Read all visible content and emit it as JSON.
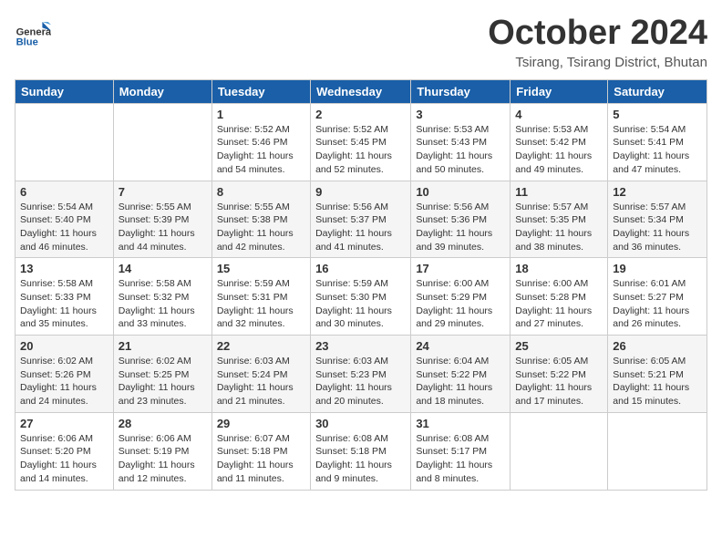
{
  "header": {
    "logo_general": "General",
    "logo_blue": "Blue",
    "month_title": "October 2024",
    "subtitle": "Tsirang, Tsirang District, Bhutan"
  },
  "days_of_week": [
    "Sunday",
    "Monday",
    "Tuesday",
    "Wednesday",
    "Thursday",
    "Friday",
    "Saturday"
  ],
  "weeks": [
    [
      {
        "day": "",
        "info": ""
      },
      {
        "day": "",
        "info": ""
      },
      {
        "day": "1",
        "info": "Sunrise: 5:52 AM\nSunset: 5:46 PM\nDaylight: 11 hours and 54 minutes."
      },
      {
        "day": "2",
        "info": "Sunrise: 5:52 AM\nSunset: 5:45 PM\nDaylight: 11 hours and 52 minutes."
      },
      {
        "day": "3",
        "info": "Sunrise: 5:53 AM\nSunset: 5:43 PM\nDaylight: 11 hours and 50 minutes."
      },
      {
        "day": "4",
        "info": "Sunrise: 5:53 AM\nSunset: 5:42 PM\nDaylight: 11 hours and 49 minutes."
      },
      {
        "day": "5",
        "info": "Sunrise: 5:54 AM\nSunset: 5:41 PM\nDaylight: 11 hours and 47 minutes."
      }
    ],
    [
      {
        "day": "6",
        "info": "Sunrise: 5:54 AM\nSunset: 5:40 PM\nDaylight: 11 hours and 46 minutes."
      },
      {
        "day": "7",
        "info": "Sunrise: 5:55 AM\nSunset: 5:39 PM\nDaylight: 11 hours and 44 minutes."
      },
      {
        "day": "8",
        "info": "Sunrise: 5:55 AM\nSunset: 5:38 PM\nDaylight: 11 hours and 42 minutes."
      },
      {
        "day": "9",
        "info": "Sunrise: 5:56 AM\nSunset: 5:37 PM\nDaylight: 11 hours and 41 minutes."
      },
      {
        "day": "10",
        "info": "Sunrise: 5:56 AM\nSunset: 5:36 PM\nDaylight: 11 hours and 39 minutes."
      },
      {
        "day": "11",
        "info": "Sunrise: 5:57 AM\nSunset: 5:35 PM\nDaylight: 11 hours and 38 minutes."
      },
      {
        "day": "12",
        "info": "Sunrise: 5:57 AM\nSunset: 5:34 PM\nDaylight: 11 hours and 36 minutes."
      }
    ],
    [
      {
        "day": "13",
        "info": "Sunrise: 5:58 AM\nSunset: 5:33 PM\nDaylight: 11 hours and 35 minutes."
      },
      {
        "day": "14",
        "info": "Sunrise: 5:58 AM\nSunset: 5:32 PM\nDaylight: 11 hours and 33 minutes."
      },
      {
        "day": "15",
        "info": "Sunrise: 5:59 AM\nSunset: 5:31 PM\nDaylight: 11 hours and 32 minutes."
      },
      {
        "day": "16",
        "info": "Sunrise: 5:59 AM\nSunset: 5:30 PM\nDaylight: 11 hours and 30 minutes."
      },
      {
        "day": "17",
        "info": "Sunrise: 6:00 AM\nSunset: 5:29 PM\nDaylight: 11 hours and 29 minutes."
      },
      {
        "day": "18",
        "info": "Sunrise: 6:00 AM\nSunset: 5:28 PM\nDaylight: 11 hours and 27 minutes."
      },
      {
        "day": "19",
        "info": "Sunrise: 6:01 AM\nSunset: 5:27 PM\nDaylight: 11 hours and 26 minutes."
      }
    ],
    [
      {
        "day": "20",
        "info": "Sunrise: 6:02 AM\nSunset: 5:26 PM\nDaylight: 11 hours and 24 minutes."
      },
      {
        "day": "21",
        "info": "Sunrise: 6:02 AM\nSunset: 5:25 PM\nDaylight: 11 hours and 23 minutes."
      },
      {
        "day": "22",
        "info": "Sunrise: 6:03 AM\nSunset: 5:24 PM\nDaylight: 11 hours and 21 minutes."
      },
      {
        "day": "23",
        "info": "Sunrise: 6:03 AM\nSunset: 5:23 PM\nDaylight: 11 hours and 20 minutes."
      },
      {
        "day": "24",
        "info": "Sunrise: 6:04 AM\nSunset: 5:22 PM\nDaylight: 11 hours and 18 minutes."
      },
      {
        "day": "25",
        "info": "Sunrise: 6:05 AM\nSunset: 5:22 PM\nDaylight: 11 hours and 17 minutes."
      },
      {
        "day": "26",
        "info": "Sunrise: 6:05 AM\nSunset: 5:21 PM\nDaylight: 11 hours and 15 minutes."
      }
    ],
    [
      {
        "day": "27",
        "info": "Sunrise: 6:06 AM\nSunset: 5:20 PM\nDaylight: 11 hours and 14 minutes."
      },
      {
        "day": "28",
        "info": "Sunrise: 6:06 AM\nSunset: 5:19 PM\nDaylight: 11 hours and 12 minutes."
      },
      {
        "day": "29",
        "info": "Sunrise: 6:07 AM\nSunset: 5:18 PM\nDaylight: 11 hours and 11 minutes."
      },
      {
        "day": "30",
        "info": "Sunrise: 6:08 AM\nSunset: 5:18 PM\nDaylight: 11 hours and 9 minutes."
      },
      {
        "day": "31",
        "info": "Sunrise: 6:08 AM\nSunset: 5:17 PM\nDaylight: 11 hours and 8 minutes."
      },
      {
        "day": "",
        "info": ""
      },
      {
        "day": "",
        "info": ""
      }
    ]
  ]
}
